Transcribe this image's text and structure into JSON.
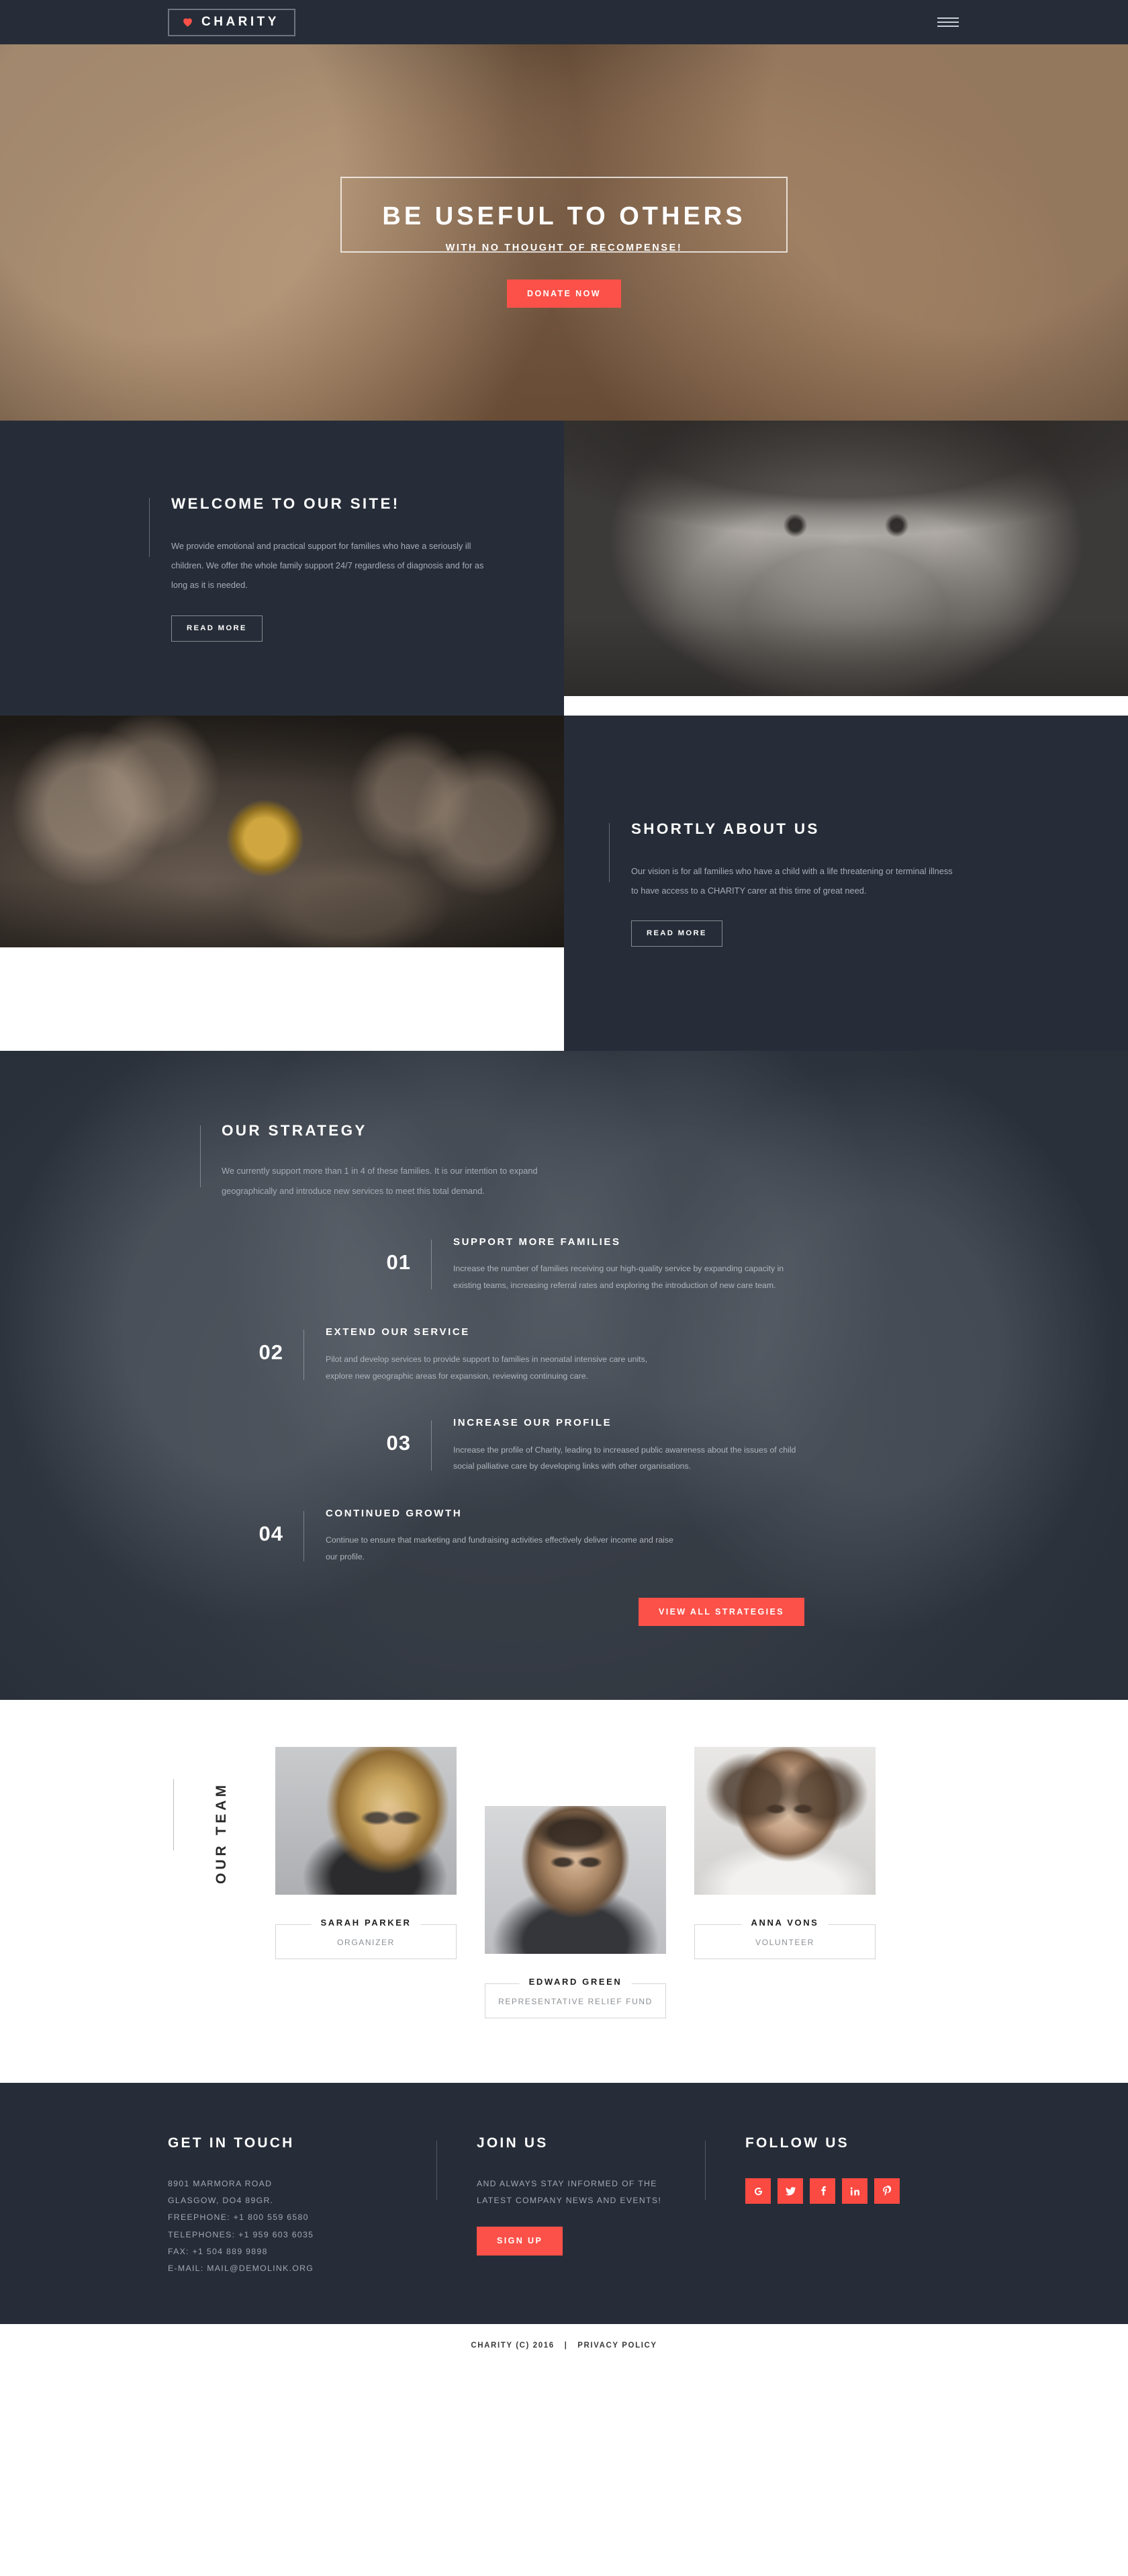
{
  "header": {
    "logo_icon": "heart-icon",
    "logo_text": "CHARITY",
    "menu_icon": "hamburger-menu-icon"
  },
  "hero": {
    "title": "BE USEFUL TO OTHERS",
    "subtitle": "WITH NO THOUGHT OF RECOMPENSE!",
    "cta_label": "DONATE NOW"
  },
  "welcome": {
    "title": "WELCOME TO OUR SITE!",
    "text": "We provide emotional and practical support for families who have a seriously ill children. We offer the whole family support 24/7 regardless of diagnosis and for as long as it is needed.",
    "button_label": "READ MORE"
  },
  "about": {
    "title": "SHORTLY ABOUT US",
    "text": "Our vision is for all families who have a child with a life threatening or terminal illness to have access to a CHARITY carer at this time of great need.",
    "button_label": "READ MORE"
  },
  "strategy": {
    "title": "OUR STRATEGY",
    "text": "We currently support more than 1 in 4 of these families. It is our intention to expand geographically and introduce new services to meet this total demand.",
    "cta_label": "VIEW ALL STRATEGIES",
    "items": [
      {
        "number": "01",
        "title": "SUPPORT MORE FAMILIES",
        "desc": "Increase the number of families receiving our high-quality service by expanding capacity in existing teams, increasing referral rates and exploring the introduction of new care team."
      },
      {
        "number": "02",
        "title": "EXTEND OUR SERVICE",
        "desc": "Pilot and develop services to provide support to families in neonatal intensive care units, explore new geographic areas for expansion,  reviewing continuing care."
      },
      {
        "number": "03",
        "title": "INCREASE OUR PROFILE",
        "desc": "Increase the profile of Charity, leading to increased public awareness about the issues of child social palliative care by developing links with other organisations."
      },
      {
        "number": "04",
        "title": "CONTINUED GROWTH",
        "desc": "Continue to ensure that marketing and fundraising activities effectively deliver income and raise our profile."
      }
    ]
  },
  "team": {
    "label": "OUR TEAM",
    "members": [
      {
        "name": "SARAH PARKER",
        "role": "ORGANIZER"
      },
      {
        "name": "EDWARD GREEN",
        "role": "REPRESENTATIVE RELIEF FUND"
      },
      {
        "name": "ANNA VONS",
        "role": "VOLUNTEER"
      }
    ]
  },
  "footer": {
    "contact": {
      "title": "GET IN TOUCH",
      "lines": [
        "8901 MARMORA ROAD",
        "GLASGOW, DO4 89GR.",
        "FREEPHONE: +1 800 559 6580",
        "TELEPHONES: +1 959 603 6035",
        "FAX: +1 504 889 9898",
        "E-MAIL: MAIL@DEMOLINK.ORG"
      ]
    },
    "join": {
      "title": "JOIN US",
      "text": "AND ALWAYS STAY INFORMED OF THE LATEST COMPANY NEWS AND EVENTS!",
      "button_label": "SIGN UP"
    },
    "follow": {
      "title": "FOLLOW US",
      "socials": [
        {
          "name": "google-plus-icon"
        },
        {
          "name": "twitter-icon"
        },
        {
          "name": "facebook-icon"
        },
        {
          "name": "linkedin-icon"
        },
        {
          "name": "pinterest-icon"
        }
      ]
    }
  },
  "copyright": {
    "text": "CHARITY (C) 2016",
    "separator": "|",
    "privacy_label": "PRIVACY POLICY"
  },
  "colors": {
    "accent": "#fc5149",
    "dark": "#262d38",
    "muted_text": "#a7adb6"
  }
}
